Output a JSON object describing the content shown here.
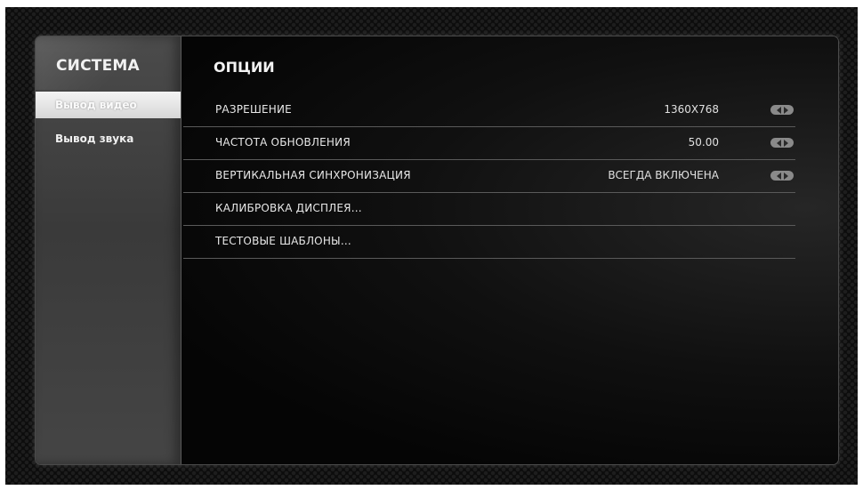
{
  "sidebar": {
    "title": "СИСТЕМА",
    "items": [
      {
        "label": "Вывод видео",
        "active": true
      },
      {
        "label": "Вывод звука",
        "active": false
      }
    ]
  },
  "main": {
    "title": "ОПЦИИ",
    "rows": [
      {
        "label": "РАЗРЕШЕНИЕ",
        "value": "1360X768",
        "icon": "left-right-arrows-icon"
      },
      {
        "label": "ЧАСТОТА ОБНОВЛЕНИЯ",
        "value": "50.00",
        "icon": "left-right-arrows-icon"
      },
      {
        "label": "ВЕРТИКАЛЬНАЯ СИНХРОНИЗАЦИЯ",
        "value": "ВСЕГДА ВКЛЮЧЕНА",
        "icon": "left-right-arrows-icon"
      },
      {
        "label": "КАЛИБРОВКА ДИСПЛЕЯ..."
      },
      {
        "label": "ТЕСТОВЫЕ ШАБЛОНЫ..."
      }
    ]
  }
}
